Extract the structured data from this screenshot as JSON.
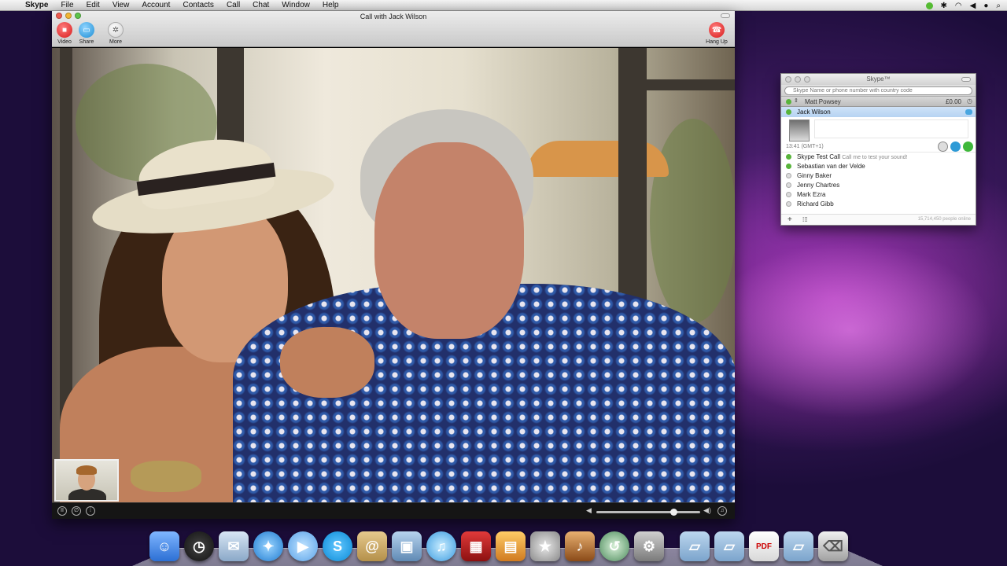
{
  "menubar": {
    "app_name": "Skype",
    "items": [
      "File",
      "Edit",
      "View",
      "Account",
      "Contacts",
      "Call",
      "Chat",
      "Window",
      "Help"
    ]
  },
  "call_window": {
    "title": "Call with Jack Wilson",
    "toolbar": {
      "video_label": "Video",
      "share_label": "Share",
      "more_label": "More",
      "hangup_label": "Hang Up"
    },
    "volume_level": 0.74
  },
  "contacts_window": {
    "title": "Skype™",
    "search_placeholder": "Skype Name or phone number with country code",
    "account_name": "Matt Powsey",
    "credit": "£0.00",
    "selected_contact": {
      "name": "Jack Wilson",
      "local_time": "13:41 (GMT+1)"
    },
    "contacts": [
      {
        "name": "Skype Test Call",
        "mood": "Call me to test your sound!",
        "status": "online"
      },
      {
        "name": "Sebastian van der Velde",
        "mood": "",
        "status": "online"
      },
      {
        "name": "Ginny Baker",
        "mood": "",
        "status": "offline"
      },
      {
        "name": "Jenny Chartres",
        "mood": "",
        "status": "offline"
      },
      {
        "name": "Mark Ezra",
        "mood": "",
        "status": "offline"
      },
      {
        "name": "Richard Gibb",
        "mood": "",
        "status": "offline"
      }
    ],
    "people_online": "15,714,450 people online"
  },
  "colors": {
    "online": "#58b43b",
    "selected_row": "#b6d3f2",
    "hangup": "#d71c1c"
  },
  "dock": {
    "items": [
      "finder-icon",
      "dashboard-icon",
      "mail-icon",
      "safari-icon",
      "ichat-icon",
      "skype-icon",
      "address-book-icon",
      "iphoto-icon",
      "itunes-icon",
      "photo-booth-icon",
      "preview-icon",
      "imovie-icon",
      "garageband-icon",
      "time-machine-icon",
      "system-preferences-icon",
      "applications-folder-icon",
      "documents-folder-icon",
      "pdf-document-icon",
      "downloads-folder-icon",
      "trash-icon"
    ]
  }
}
